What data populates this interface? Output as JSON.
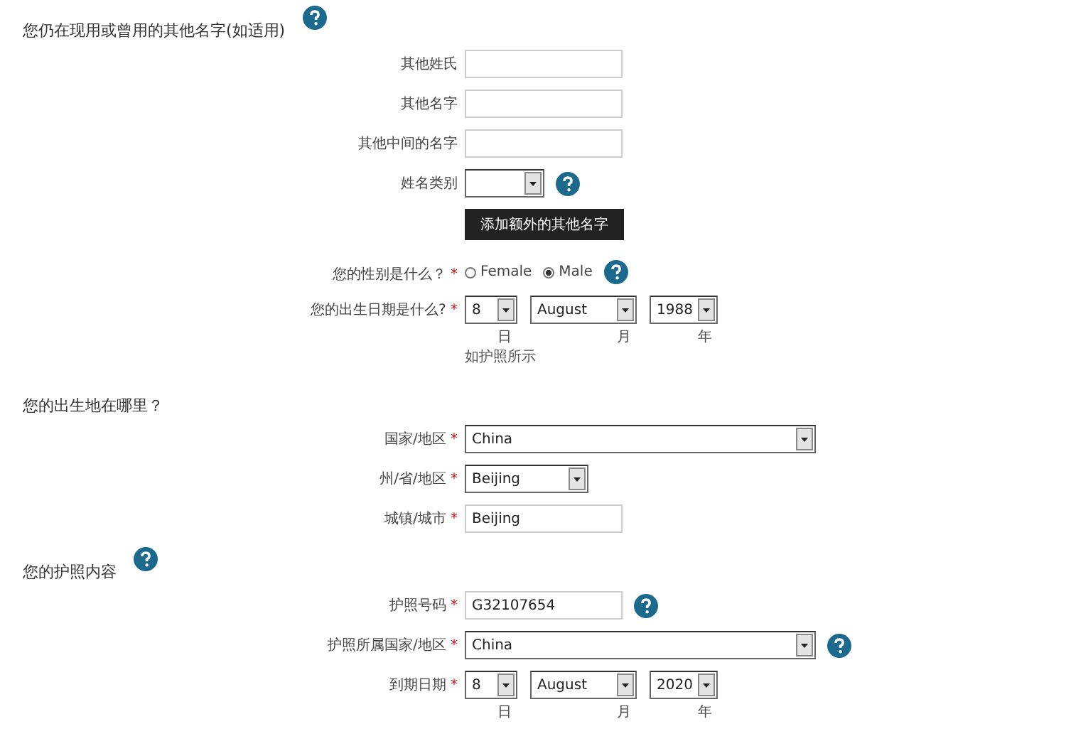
{
  "sections": [
    {
      "heading": "您仍在现用或曾用的其他名字(如适用)",
      "help": true,
      "rows": [
        {
          "kind": "text",
          "label": "其他姓氏",
          "value": ""
        },
        {
          "kind": "text",
          "label": "其他名字",
          "value": ""
        },
        {
          "kind": "text",
          "label": "其他中间的名字",
          "value": ""
        },
        {
          "kind": "select",
          "label": "姓名类别",
          "value": "",
          "help": true
        },
        {
          "kind": "button",
          "text": "添加额外的其他名字"
        },
        {
          "kind": "radio",
          "label": "您的性别是什么？",
          "marker": "*",
          "help": true,
          "options": [
            {
              "label": "Female",
              "selected": false
            },
            {
              "label": "Male",
              "selected": true
            }
          ]
        },
        {
          "kind": "date",
          "label": "您的出生日期是什么?",
          "marker": "*",
          "parts": [
            {
              "value": "8",
              "unit": "日"
            },
            {
              "value": "August",
              "unit": "月"
            },
            {
              "value": "1988",
              "unit": "年"
            }
          ],
          "note": "如护照所示"
        }
      ]
    },
    {
      "heading": "您的出生地在哪里？",
      "help": false,
      "rows": [
        {
          "kind": "select",
          "label": "国家/地区",
          "marker": "*",
          "value": "China"
        },
        {
          "kind": "select",
          "label": "州/省/地区",
          "marker": "*",
          "value": "Beijing"
        },
        {
          "kind": "text",
          "label": "城镇/城市",
          "marker": "*",
          "value": "Beijing"
        }
      ]
    },
    {
      "heading": "您的护照内容",
      "help": true,
      "rows": [
        {
          "kind": "text",
          "label": "护照号码",
          "marker": "*",
          "value": "G32107654",
          "help": true
        },
        {
          "kind": "select",
          "label": "护照所属国家/地区",
          "marker": "*",
          "value": "China",
          "help": true
        },
        {
          "kind": "date",
          "label": "到期日期",
          "marker": "*",
          "parts": [
            {
              "value": "8",
              "unit": "日"
            },
            {
              "value": "August",
              "unit": "月"
            },
            {
              "value": "2020",
              "unit": "年"
            }
          ]
        }
      ]
    }
  ]
}
